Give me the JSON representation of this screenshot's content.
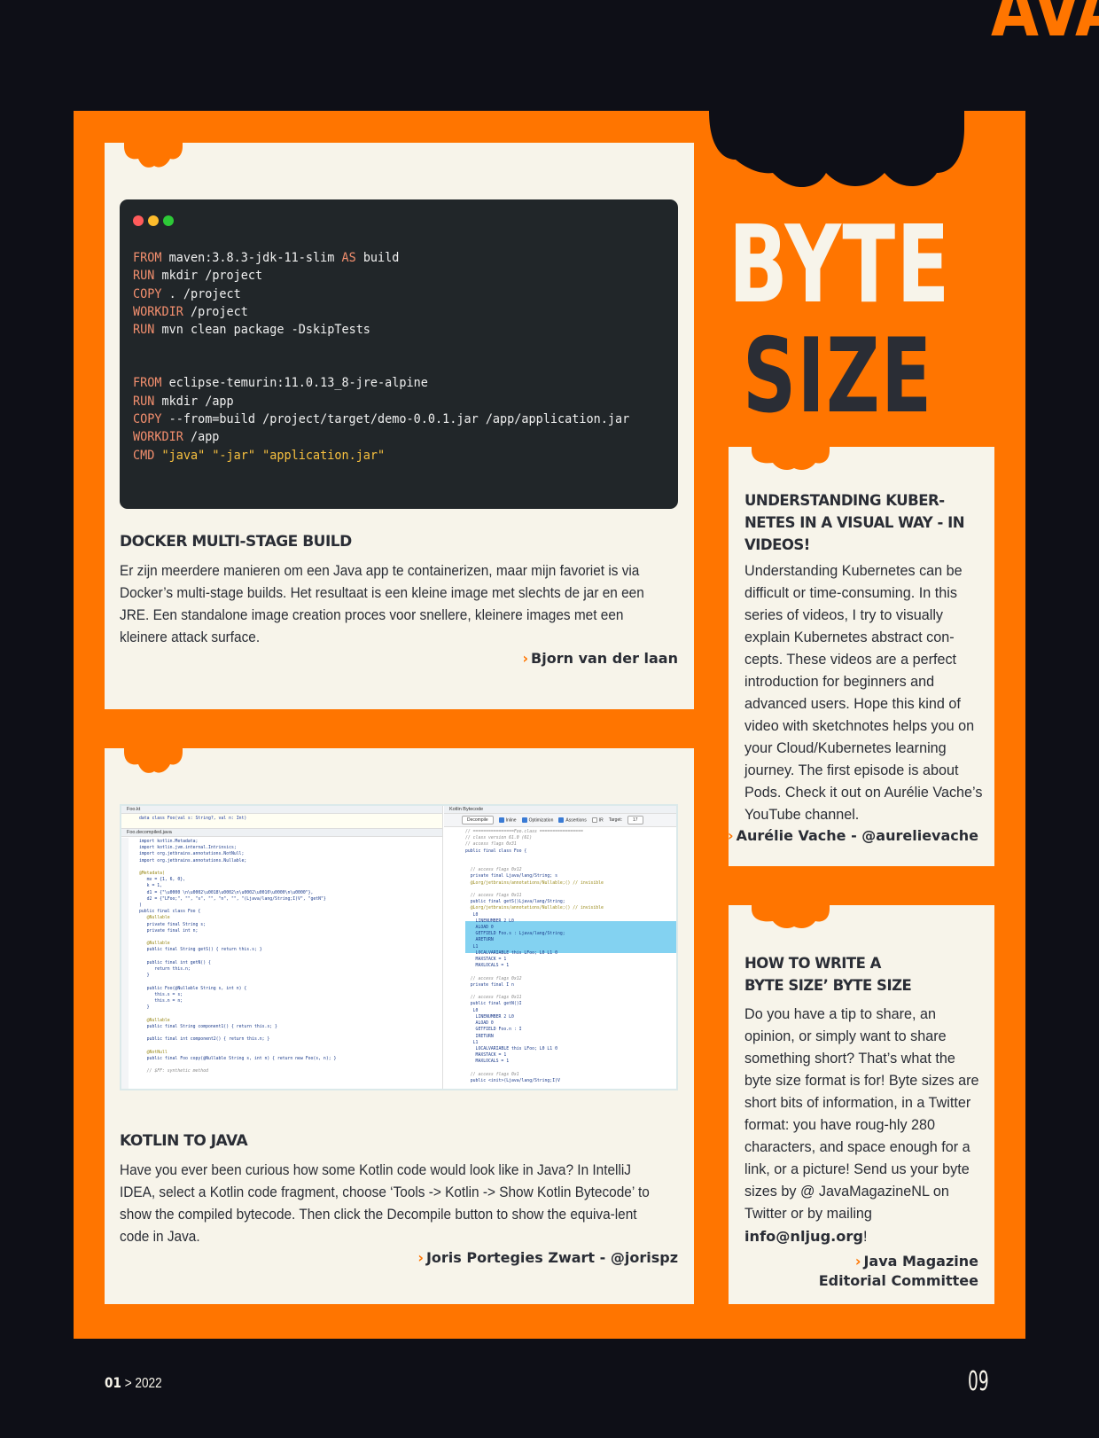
{
  "header": {
    "logo_fragment": "AVA"
  },
  "section": {
    "title_line1": "BYTE",
    "title_line2": "SIZE"
  },
  "colors": {
    "accent": "#ff7500",
    "background": "#0e0f17",
    "card": "#f7f4ea",
    "text": "#2a2d35"
  },
  "docker": {
    "code": {
      "stage1": [
        {
          "kw": "FROM",
          "rest": " maven:3.8.3-jdk-11-slim ",
          "kw2": "AS",
          "rest2": " build"
        },
        {
          "kw": "RUN",
          "rest": " mkdir /project"
        },
        {
          "kw": "COPY",
          "rest": " . /project"
        },
        {
          "kw": "WORKDIR",
          "rest": " /project"
        },
        {
          "kw": "RUN",
          "rest": " mvn clean package -DskipTests"
        }
      ],
      "stage2": [
        {
          "kw": "FROM",
          "rest": " eclipse-temurin:11.0.13_8-jre-alpine"
        },
        {
          "kw": "RUN",
          "rest": " mkdir /app"
        },
        {
          "kw": "COPY",
          "rest": " --from=build /project/target/demo-0.0.1.jar /app/application.jar"
        },
        {
          "kw": "WORKDIR",
          "rest": " /app"
        },
        {
          "kw": "CMD",
          "str": " \"java\" \"-jar\" \"application.jar\""
        }
      ]
    },
    "title": "DOCKER MULTI-STAGE BUILD",
    "body": "Er zijn meerdere manieren om een Java app te containerizen, maar mijn favoriet is via Docker’s multi-stage builds. Het resultaat is een kleine image met slechts de jar en een JRE. Een standalone image creation proces voor snellere, kleinere images met een kleinere attack surface.",
    "author": "Bjorn van der laan"
  },
  "kotlin": {
    "ide": {
      "kotlin_tab": "Foo.kt",
      "kotlin_line": "data class Foo(val s: String?, val n: Int)",
      "decompiled_tab": "Foo.decompiled.java",
      "bytecode_tab": "Kotlin Bytecode",
      "decompile_button": "Decompile",
      "options": [
        "Inline",
        "Optimization",
        "Assertions",
        "IR"
      ],
      "target_label": "Target:",
      "target_value": "17",
      "left_code": [
        "import kotlin.Metadata;",
        "import kotlin.jvm.internal.Intrinsics;",
        "import org.jetbrains.annotations.NotNull;",
        "import org.jetbrains.annotations.Nullable;",
        "",
        "@Metadata(",
        "   mv = {1, 6, 0},",
        "   k = 1,",
        "   d1 = {\"\\u0000 \\n\\u0002\\u0018\\u0002\\n\\u0002\\u0010\\u0000\\n\\u0000\"},",
        "   d2 = {\"LFoo;\", \"\", \"s\", \"\", \"n\", \"\", \"(Ljava/lang/String;I)V\", \"getN\"}",
        ")",
        "public final class Foo {",
        "   @Nullable",
        "   private final String s;",
        "   private final int n;",
        "",
        "   @Nullable",
        "   public final String getS() { return this.s; }",
        "",
        "   public final int getN() {",
        "      return this.n;",
        "   }",
        "",
        "   public Foo(@Nullable String s, int n) {",
        "      this.s = s;",
        "      this.n = n;",
        "   }",
        "",
        "   @Nullable",
        "   public final String component1() { return this.s; }",
        "",
        "   public final int component2() { return this.n; }",
        "",
        "   @NotNull",
        "   public final Foo copy(@Nullable String s, int n) { return new Foo(s, n); }",
        "",
        "   // $FF: synthetic method"
      ],
      "right_code": [
        "// ================Foo.class =================",
        "// class version 61.0 (61)",
        "// access flags 0x31",
        "public final class Foo {",
        "",
        "",
        "  // access flags 0x12",
        "  private final Ljava/lang/String; s",
        "  @Lorg/jetbrains/annotations/Nullable;() // invisible",
        "",
        "  // access flags 0x11",
        "  public final getS()Ljava/lang/String;",
        "  @Lorg/jetbrains/annotations/Nullable;() // invisible",
        "   L0",
        "    LINENUMBER 2 L0",
        "    ALOAD 0",
        "    GETFIELD Foo.s : Ljava/lang/String;",
        "    ARETURN",
        "   L1",
        "    LOCALVARIABLE this LFoo; L0 L1 0",
        "    MAXSTACK = 1",
        "    MAXLOCALS = 1",
        "",
        "  // access flags 0x12",
        "  private final I n",
        "",
        "  // access flags 0x11",
        "  public final getN()I",
        "   L0",
        "    LINENUMBER 2 L0",
        "    ALOAD 0",
        "    GETFIELD Foo.n : I",
        "    IRETURN",
        "   L1",
        "    LOCALVARIABLE this LFoo; L0 L1 0",
        "    MAXSTACK = 1",
        "    MAXLOCALS = 1",
        "",
        "  // access flags 0x1",
        "  public <init>(Ljava/lang/String;I)V"
      ]
    },
    "title": "KOTLIN TO JAVA",
    "body": "Have you ever been curious how some Kotlin code would look like in Java? In IntelliJ IDEA, select a Kotlin code fragment, choose ‘Tools -> Kotlin -> Show Kotlin Bytecode’ to show the compiled bytecode. Then click the Decompile button to show the equiva-lent code in Java.",
    "author": "Joris Portegies Zwart - @jorispz"
  },
  "kubernetes": {
    "title": "UNDERSTANDING KUBER-NETES IN A VISUAL WAY - IN VIDEOS!",
    "body": "Understanding Kubernetes can be difficult or time-consuming. In this series of videos, I try to visually explain Kubernetes abstract con-cepts. These videos are a perfect introduction for beginners and advanced users. Hope this kind of video with sketchnotes helps you on your Cloud/Kubernetes learning journey. The first episode is about Pods. Check it out on Aurélie Vache’s YouTube channel.",
    "author": "Aurélie Vache - @aurelievache"
  },
  "howto": {
    "title_line1": "HOW TO WRITE A",
    "title_line2": "BYTE SIZE’ BYTE SIZE",
    "body_before": "Do you have a tip to share, an opinion, or simply want to share something short? That’s what the byte size format is for! Byte sizes are short bits of information, in a Twitter format: you have roug-hly 280 characters, and space enough for a link, or a picture! Send us your byte sizes by @ JavaMagazineNL on Twitter or by mailing ",
    "email": "info@nljug.org",
    "body_after": "!",
    "author_line1": "Java Magazine",
    "author_line2": "Editorial Committee"
  },
  "footer": {
    "issue": "01",
    "separator": " > ",
    "year": "2022",
    "page_number": "09"
  }
}
